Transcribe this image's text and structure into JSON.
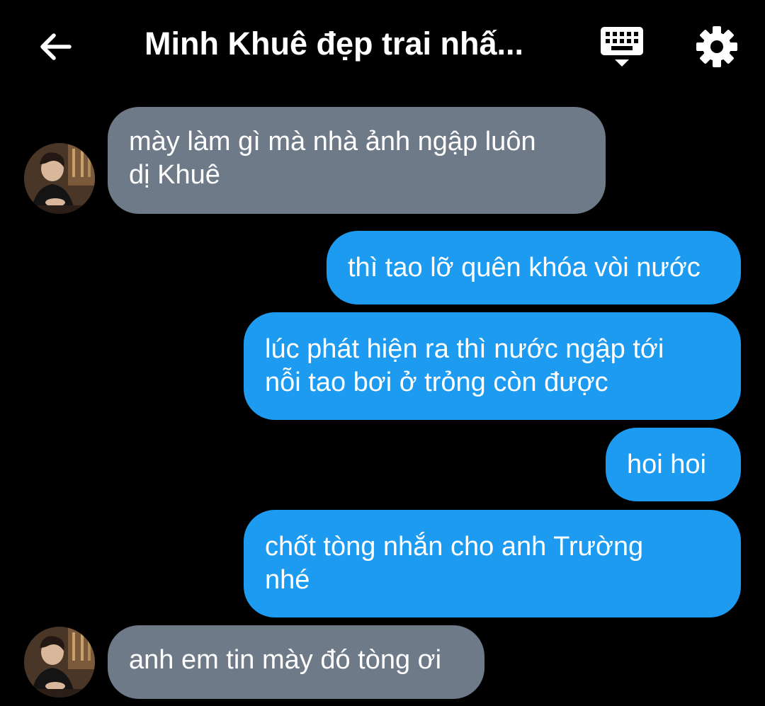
{
  "header": {
    "title": "Minh Khuê đẹp trai nhấ...",
    "back_icon": "arrow-left-icon",
    "keyboard_icon": "keyboard-icon",
    "settings_icon": "gear-icon"
  },
  "messages": [
    {
      "direction": "incoming",
      "text": "mày làm gì mà nhà ảnh ngập luôn\ndị Khuê"
    },
    {
      "direction": "outgoing",
      "text": "thì tao lỡ quên khóa vòi nước"
    },
    {
      "direction": "outgoing",
      "text": "lúc phát hiện ra thì nước ngập tới\nnỗi tao bơi ở trỏng còn được"
    },
    {
      "direction": "outgoing",
      "text": "hoi hoi"
    },
    {
      "direction": "outgoing",
      "text": "chốt tòng nhắn cho anh Trường\nnhé"
    },
    {
      "direction": "incoming",
      "text": "anh em tin mày đó tòng ơi"
    }
  ],
  "colors": {
    "background": "#000000",
    "incoming_bubble": "#6e7a88",
    "outgoing_bubble": "#1d9bf0",
    "text": "#ffffff"
  }
}
